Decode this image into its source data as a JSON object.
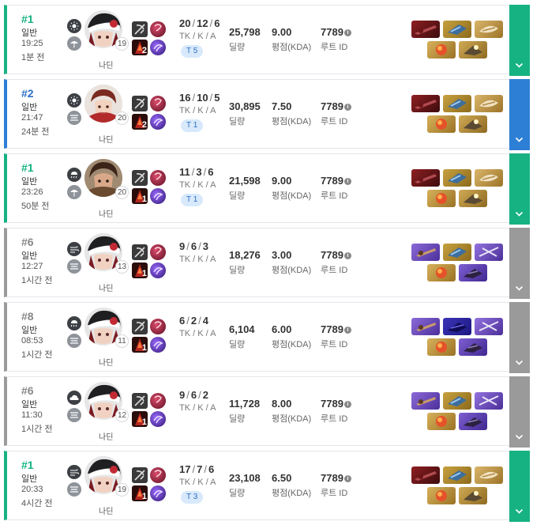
{
  "rows": [
    {
      "rank": "#1",
      "rank_color": "#16b282",
      "bar_color": "#16b282",
      "mode": "일반",
      "clock": "19:25",
      "ago": "1분 전",
      "level": "19",
      "character": "나딘",
      "avatar": "a",
      "w1": "sun",
      "w2": "umbrella",
      "k": "20",
      "tk": "12",
      "a": "6",
      "tka": "TK / K / A",
      "tier": "T 5",
      "skill_num": "2",
      "damage": "25,798",
      "damage_label": "딜량",
      "avg": "9.00",
      "avg_label": "평점(KDA)",
      "route": "7789",
      "route_label": "루트 ID",
      "items": [
        "red",
        "blue",
        "gold",
        "orange",
        "gold2"
      ]
    },
    {
      "rank": "#2",
      "rank_color": "#2c6fc5",
      "bar_color": "#2d7fd6",
      "mode": "일반",
      "clock": "21:47",
      "ago": "24분 전",
      "level": "20",
      "character": "나딘",
      "avatar": "b",
      "w1": "sun",
      "w2": "fog",
      "k": "16",
      "tk": "10",
      "a": "5",
      "tka": "TK / K / A",
      "tier": "T 1",
      "skill_num": "2",
      "damage": "30,895",
      "damage_label": "딜량",
      "avg": "7.50",
      "avg_label": "평점(KDA)",
      "route": "7789",
      "route_label": "루트 ID",
      "items": [
        "red",
        "blue",
        "gold",
        "orange",
        "gold2"
      ]
    },
    {
      "rank": "#1",
      "rank_color": "#16b282",
      "bar_color": "#16b282",
      "mode": "일반",
      "clock": "23:26",
      "ago": "50분 전",
      "level": "20",
      "character": "나딘",
      "avatar": "c",
      "w1": "rain",
      "w2": "umbrella",
      "k": "11",
      "tk": "3",
      "a": "6",
      "tka": "TK / K / A",
      "tier": "T 1",
      "skill_num": "1",
      "damage": "21,598",
      "damage_label": "딜량",
      "avg": "9.00",
      "avg_label": "평점(KDA)",
      "route": "7789",
      "route_label": "루트 ID",
      "items": [
        "red",
        "blue",
        "gold",
        "orange",
        "gold2"
      ]
    },
    {
      "rank": "#6",
      "rank_color": "#888888",
      "bar_color": "#9a9a9a",
      "mode": "일반",
      "clock": "12:27",
      "ago": "1시간 전",
      "level": "13",
      "character": "나딘",
      "avatar": "a",
      "w1": "wind",
      "w2": "fog",
      "k": "9",
      "tk": "6",
      "a": "3",
      "tka": "TK / K / A",
      "tier": "",
      "skill_num": "1",
      "damage": "18,276",
      "damage_label": "딜량",
      "avg": "3.00",
      "avg_label": "평점(KDA)",
      "route": "7789",
      "route_label": "루트 ID",
      "items": [
        "purple",
        "blue",
        "purple2",
        "orange",
        "purple3"
      ]
    },
    {
      "rank": "#8",
      "rank_color": "#888888",
      "bar_color": "#9a9a9a",
      "mode": "일반",
      "clock": "08:53",
      "ago": "1시간 전",
      "level": "11",
      "character": "나딘",
      "avatar": "a",
      "w1": "rain",
      "w2": "fog",
      "k": "6",
      "tk": "2",
      "a": "4",
      "tka": "TK / K / A",
      "tier": "",
      "skill_num": "1",
      "damage": "6,104",
      "damage_label": "딜량",
      "avg": "6.00",
      "avg_label": "평점(KDA)",
      "route": "7789",
      "route_label": "루트 ID",
      "items": [
        "purple",
        "navy",
        "purple2",
        "orange",
        "purple3"
      ]
    },
    {
      "rank": "#6",
      "rank_color": "#888888",
      "bar_color": "#9a9a9a",
      "mode": "일반",
      "clock": "11:30",
      "ago": "1시간 전",
      "level": "12",
      "character": "나딘",
      "avatar": "a",
      "w1": "cloud",
      "w2": "fog",
      "k": "9",
      "tk": "6",
      "a": "2",
      "tka": "TK / K / A",
      "tier": "",
      "skill_num": "1",
      "damage": "11,728",
      "damage_label": "딜량",
      "avg": "8.00",
      "avg_label": "평점(KDA)",
      "route": "7789",
      "route_label": "루트 ID",
      "items": [
        "purple",
        "blue",
        "purple2",
        "orange",
        "purple3"
      ]
    },
    {
      "rank": "#1",
      "rank_color": "#16b282",
      "bar_color": "#16b282",
      "mode": "일반",
      "clock": "20:33",
      "ago": "4시간 전",
      "level": "19",
      "character": "나딘",
      "avatar": "a",
      "w1": "wind",
      "w2": "fog",
      "k": "17",
      "tk": "7",
      "a": "6",
      "tka": "TK / K / A",
      "tier": "T 3",
      "skill_num": "1",
      "damage": "23,108",
      "damage_label": "딜량",
      "avg": "6.50",
      "avg_label": "평점(KDA)",
      "route": "7789",
      "route_label": "루트 ID",
      "items": [
        "red",
        "blue",
        "gold",
        "orange",
        "gold2"
      ]
    }
  ]
}
